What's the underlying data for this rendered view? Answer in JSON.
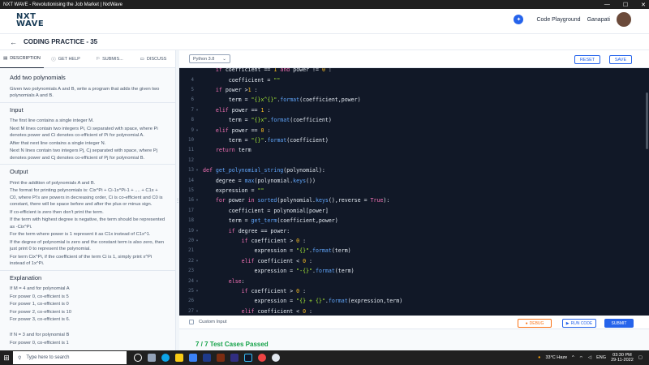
{
  "window": {
    "title": "NXT WAVE - Revolutionising the Job Market | NxtWave"
  },
  "header": {
    "logo_line1": "NXT",
    "logo_line2": "WAVE",
    "playground": "Code Playground",
    "user": "Ganapati"
  },
  "practice": {
    "title": "CODING PRACTICE - 35"
  },
  "left_tabs": [
    {
      "label": "DESCRIPTION"
    },
    {
      "label": "GET HELP"
    },
    {
      "label": "SUBMIS..."
    },
    {
      "label": "DISCUSS"
    }
  ],
  "description": {
    "title": "Add two polynomials",
    "intro": "Given two polynomials A and B, write a program that adds the given two polynomials A and B.",
    "input_heading": "Input",
    "input_lines": [
      "The first line contains a single integer M.",
      "Next M lines contain two integers Pi, Ci separated with space, where Pi denotes power and Ci denotes co-efficient of Pi for polynomial A.",
      "After that next line contains a single integer N.",
      "Next N lines contain two integers Pj, Cj separated with space, where Pj denotes power and Cj denotes co-efficient of Pj for polynomial B."
    ],
    "output_heading": "Output",
    "output_lines": [
      "Print the addition of polynomials A and B.",
      "The format for printing polynomials is: Cix^Pi + Ci-1x^Pi-1 + .... + C1x + C0, where Pi's are powers in decreasing order, Ci is co-efficient and C0 is constant, there will be space before and after the plus or minus sign.",
      "If co-efficient is zero then don't print the term.",
      "If the term with highest degree is negative, the term should be represented as -Cix^Pi.",
      "For the term where power is 1 represent it as C1x instead of C1x^1.",
      "If the degree of polynomial is zero and the constant term is also zero, then just print 0 to represent the polynomial.",
      "For term Cix^Pi, if the coefficient of the term Ci is 1, simply print x^Pi instead of 1x^Pi."
    ],
    "explanation_heading": "Explanation",
    "explanation_lines": [
      "If M = 4 and for polynomial A",
      "For power 0, co-efficient is 5",
      "For power 1, co-efficient is 0",
      "For power 2, co-efficient is 10",
      "For power 3, co-efficient is 6.",
      "",
      "If N = 3 and for polynomial B",
      "For power 0, co-efficient is 1"
    ]
  },
  "editor": {
    "language": "Python 3.8",
    "reset": "RESET",
    "save": "SAVE",
    "lines": [
      {
        "n": "",
        "fold": "",
        "html": "    <span class=\"kw\">if</span> coefficient == <span class=\"num\">1</span> <span class=\"kw\">and</span> power != <span class=\"num\">0</span> :"
      },
      {
        "n": "4",
        "fold": "",
        "html": "        coefficient = <span class=\"str\">\"\"</span>"
      },
      {
        "n": "5",
        "fold": "",
        "html": "    <span class=\"kw\">if</span> power &gt;<span class=\"num\">1</span> :"
      },
      {
        "n": "6",
        "fold": "",
        "html": "        term = <span class=\"str\">\"{}x^{}\"</span>.<span class=\"fn\">format</span>(coefficient,power)"
      },
      {
        "n": "7",
        "fold": "▾",
        "html": "    <span class=\"kw\">elif</span> power == <span class=\"num\">1</span> :"
      },
      {
        "n": "8",
        "fold": "",
        "html": "        term = <span class=\"str\">\"{}x\"</span>.<span class=\"fn\">format</span>(coefficient)"
      },
      {
        "n": "9",
        "fold": "▾",
        "html": "    <span class=\"kw\">elif</span> power == <span class=\"num\">0</span> :"
      },
      {
        "n": "10",
        "fold": "",
        "html": "        term = <span class=\"str\">\"{}\"</span>.<span class=\"fn\">format</span>(coefficient)"
      },
      {
        "n": "11",
        "fold": "",
        "html": "    <span class=\"kw\">return</span> term"
      },
      {
        "n": "12",
        "fold": "",
        "html": ""
      },
      {
        "n": "13",
        "fold": "▾",
        "html": "<span class=\"kw\">def</span> <span class=\"fn\">get_polynomial_string</span>(polynomial):"
      },
      {
        "n": "14",
        "fold": "",
        "html": "    degree = <span class=\"fn\">max</span>(polynomial.<span class=\"fn\">keys</span>())"
      },
      {
        "n": "15",
        "fold": "",
        "html": "    expression = <span class=\"str\">\"\"</span>"
      },
      {
        "n": "16",
        "fold": "▾",
        "html": "    <span class=\"kw\">for</span> power <span class=\"kw\">in</span> <span class=\"fn\">sorted</span>(polynomial.<span class=\"fn\">keys</span>(),reverse = <span class=\"kw\">True</span>):"
      },
      {
        "n": "17",
        "fold": "",
        "html": "        coefficient = polynomial[power]"
      },
      {
        "n": "18",
        "fold": "",
        "html": "        term = <span class=\"fn\">get_term</span>(coefficient,power)"
      },
      {
        "n": "19",
        "fold": "▾",
        "html": "        <span class=\"kw\">if</span> degree == power:"
      },
      {
        "n": "20",
        "fold": "▾",
        "html": "            <span class=\"kw\">if</span> coefficient &gt; <span class=\"num\">0</span> :"
      },
      {
        "n": "21",
        "fold": "",
        "html": "                expression = <span class=\"str\">\"{}\"</span>.<span class=\"fn\">format</span>(term)"
      },
      {
        "n": "22",
        "fold": "▾",
        "html": "            <span class=\"kw\">elif</span> coefficient &lt; <span class=\"num\">0</span> :"
      },
      {
        "n": "23",
        "fold": "",
        "html": "                expression = <span class=\"str\">\"-{}\"</span>.<span class=\"fn\">format</span>(term)"
      },
      {
        "n": "24",
        "fold": "▾",
        "html": "        <span class=\"kw\">else</span>:"
      },
      {
        "n": "25",
        "fold": "▾",
        "html": "            <span class=\"kw\">if</span> coefficient &gt; <span class=\"num\">0</span> :"
      },
      {
        "n": "26",
        "fold": "",
        "html": "                expression = <span class=\"str\">\"{} + {}\"</span>.<span class=\"fn\">format</span>(expression,term)"
      },
      {
        "n": "27",
        "fold": "▾",
        "html": "            <span class=\"kw\">elif</span> coefficient &lt; <span class=\"num\">0</span> :"
      }
    ]
  },
  "bottom": {
    "custom_input": "Custom Input",
    "debug": "DEBUG",
    "run": "RUN CODE",
    "submit": "SUBMIT"
  },
  "results": {
    "text": "7 / 7 Test Cases Passed"
  },
  "taskbar": {
    "search_placeholder": "Type here to search",
    "weather": "33°C  Haze",
    "lang": "ENG",
    "time": "03:30 PM",
    "date": "29-11-2022"
  },
  "colors": {
    "accent": "#2563eb",
    "success": "#16a34a",
    "debug": "#f97316",
    "editor_bg": "#111827"
  }
}
